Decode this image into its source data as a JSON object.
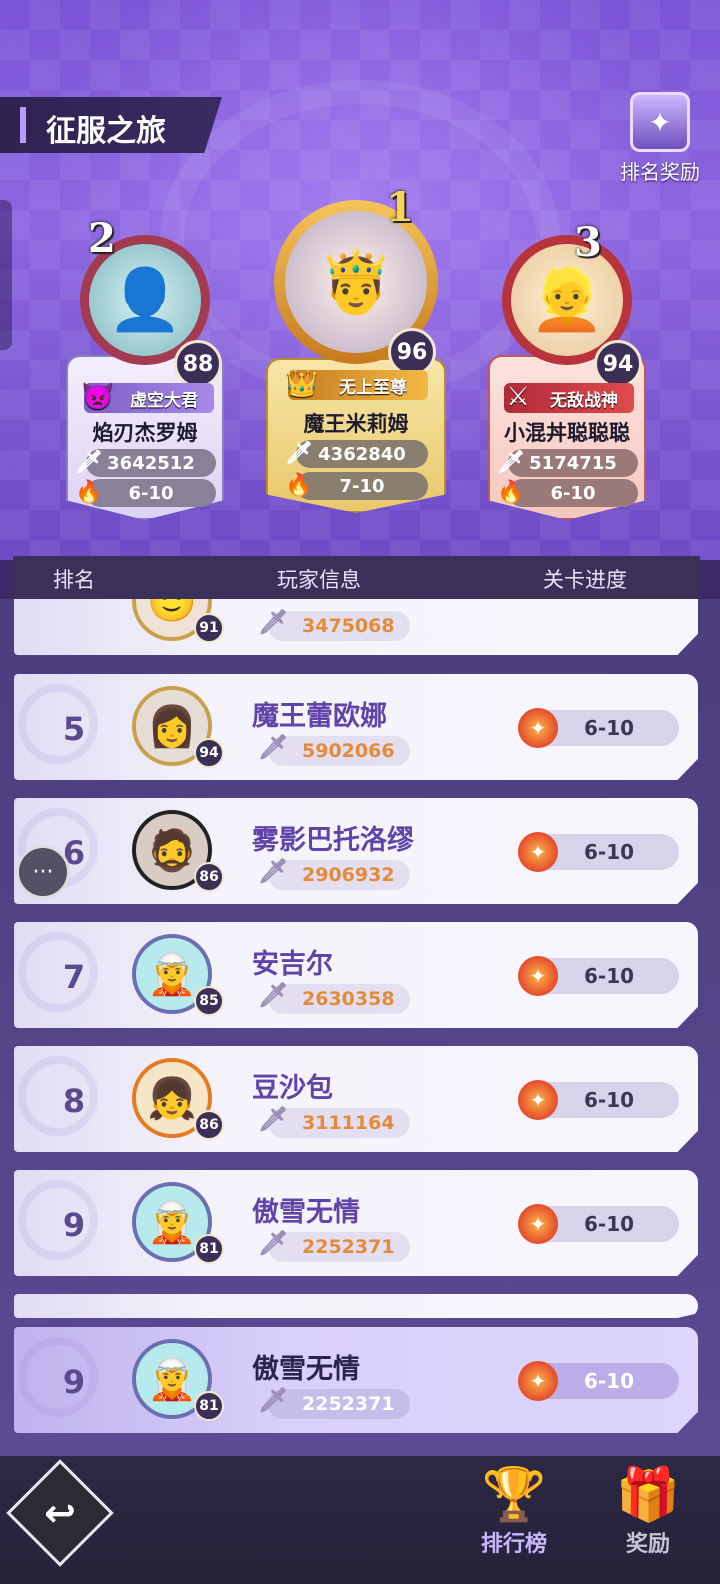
{
  "header": {
    "title": "征服之旅",
    "reward_label": "排名奖励"
  },
  "podium": [
    {
      "rank": "1",
      "level": "96",
      "title": "无上至尊",
      "name": "魔王米莉姆",
      "power": "4362840",
      "stage": "7-10"
    },
    {
      "rank": "2",
      "level": "88",
      "title": "虚空大君",
      "name": "焰刃杰罗姆",
      "power": "3642512",
      "stage": "6-10"
    },
    {
      "rank": "3",
      "level": "94",
      "title": "无敌战神",
      "name": "小混丼聪聪聪",
      "power": "5174715",
      "stage": "6-10"
    }
  ],
  "table": {
    "headers": {
      "rank": "排名",
      "player": "玩家信息",
      "progress": "关卡进度"
    },
    "partial_top": {
      "level": "91",
      "power": "3475068"
    },
    "rows": [
      {
        "rank": "5",
        "level": "94",
        "name": "魔王蕾欧娜",
        "power": "5902066",
        "stage": "6-10"
      },
      {
        "rank": "6",
        "level": "86",
        "name": "雾影巴托洛缪",
        "power": "2906932",
        "stage": "6-10"
      },
      {
        "rank": "7",
        "level": "85",
        "name": "安吉尔",
        "power": "2630358",
        "stage": "6-10"
      },
      {
        "rank": "8",
        "level": "86",
        "name": "豆沙包",
        "power": "3111164",
        "stage": "6-10"
      },
      {
        "rank": "9",
        "level": "81",
        "name": "傲雪无情",
        "power": "2252371",
        "stage": "6-10"
      }
    ]
  },
  "my_rank": {
    "rank": "9",
    "level": "81",
    "name": "傲雪无情",
    "power": "2252371",
    "stage": "6-10"
  },
  "bottom_nav": {
    "leaderboard_label": "排行榜",
    "rewards_label": "奖励"
  },
  "colors": {
    "accent": "#8c66e0",
    "gold": "#f0c862",
    "active_nav": "#c9b6ff"
  }
}
